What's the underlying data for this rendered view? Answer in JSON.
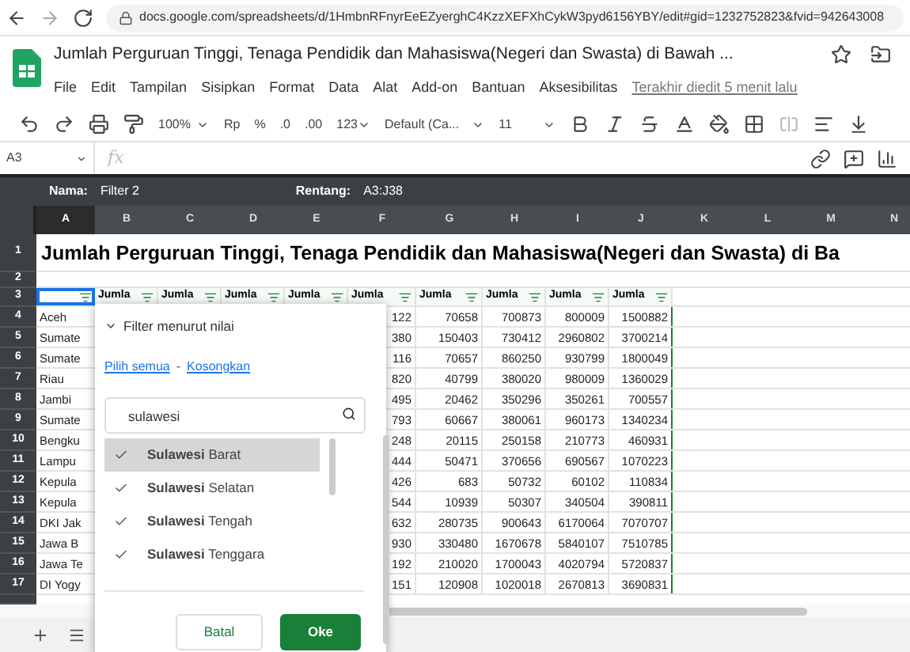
{
  "browser": {
    "url": "docs.google.com/spreadsheets/d/1HmbnRFnyrEeEZyerghC4KzzXEFXhCykW3pyd6156YBY/edit#gid=1232752823&fvid=942643008"
  },
  "document": {
    "title": "Jumlah Perguruan Tinggi, Tenaga Pendidik dan Mahasiswa(Negeri dan Swasta) di Bawah ...",
    "menu": [
      "File",
      "Edit",
      "Tampilan",
      "Sisipkan",
      "Format",
      "Data",
      "Alat",
      "Add-on",
      "Bantuan",
      "Aksesibilitas"
    ],
    "last_edit": "Terakhir diedit 5 menit lalu"
  },
  "toolbar": {
    "zoom": "100%",
    "currency": "Rp",
    "percent": "%",
    "decimal_less": ".0",
    "decimal_more": ".00",
    "number_format": "123",
    "font": "Default (Ca...",
    "font_size": "11"
  },
  "formula_bar": {
    "cell_ref": "A3",
    "fx": "fx"
  },
  "filter_bar": {
    "name_label": "Nama:",
    "name": "Filter 2",
    "range_label": "Rentang:",
    "range": "A3:J38"
  },
  "sheet": {
    "columns": [
      {
        "letter": "A",
        "selected": true
      },
      {
        "letter": "B",
        "selected": false
      },
      {
        "letter": "C",
        "selected": false
      },
      {
        "letter": "D",
        "selected": false
      },
      {
        "letter": "E",
        "selected": false
      },
      {
        "letter": "F",
        "selected": false
      },
      {
        "letter": "G",
        "selected": false
      },
      {
        "letter": "H",
        "selected": false
      },
      {
        "letter": "I",
        "selected": false
      },
      {
        "letter": "J",
        "selected": false
      },
      {
        "letter": "K",
        "selected": false
      },
      {
        "letter": "L",
        "selected": false
      },
      {
        "letter": "M",
        "selected": false
      },
      {
        "letter": "N",
        "selected": false
      }
    ],
    "title_row": {
      "number": "1",
      "text": "Jumlah Perguruan Tinggi, Tenaga Pendidik dan Mahasiswa(Negeri dan Swasta) di Ba"
    },
    "empty_row": {
      "number": "2"
    },
    "header_row": {
      "number": "3",
      "headers": [
        "Jumla",
        "Jumla",
        "Jumla",
        "Jumla",
        "Jumla",
        "Jumla",
        "Jumla",
        "Jumla",
        "Jumla"
      ]
    },
    "data_rows": [
      {
        "number": "4",
        "A": "Aceh",
        "F": "122",
        "G": "70658",
        "H": "700873",
        "I": "800009",
        "J": "1500882"
      },
      {
        "number": "5",
        "A": "Sumate",
        "F": "380",
        "G": "150403",
        "H": "730412",
        "I": "2960802",
        "J": "3700214"
      },
      {
        "number": "6",
        "A": "Sumate",
        "F": "116",
        "G": "70657",
        "H": "860250",
        "I": "930799",
        "J": "1800049"
      },
      {
        "number": "7",
        "A": "Riau",
        "F": "820",
        "G": "40799",
        "H": "380020",
        "I": "980009",
        "J": "1360029"
      },
      {
        "number": "8",
        "A": "Jambi",
        "F": "495",
        "G": "20462",
        "H": "350296",
        "I": "350261",
        "J": "700557"
      },
      {
        "number": "9",
        "A": "Sumate",
        "F": "793",
        "G": "60667",
        "H": "380061",
        "I": "960173",
        "J": "1340234"
      },
      {
        "number": "10",
        "A": "Bengku",
        "F": "248",
        "G": "20115",
        "H": "250158",
        "I": "210773",
        "J": "460931"
      },
      {
        "number": "11",
        "A": "Lampu",
        "F": "444",
        "G": "50471",
        "H": "370656",
        "I": "690567",
        "J": "1070223"
      },
      {
        "number": "12",
        "A": "Kepula",
        "F": "426",
        "G": "683",
        "H": "50732",
        "I": "60102",
        "J": "110834"
      },
      {
        "number": "13",
        "A": "Kepula",
        "F": "544",
        "G": "10939",
        "H": "50307",
        "I": "340504",
        "J": "390811"
      },
      {
        "number": "14",
        "A": "DKI Jak",
        "F": "632",
        "G": "280735",
        "H": "900643",
        "I": "6170064",
        "J": "7070707"
      },
      {
        "number": "15",
        "A": "Jawa B",
        "F": "930",
        "G": "330480",
        "H": "1670678",
        "I": "5840107",
        "J": "7510785"
      },
      {
        "number": "16",
        "A": "Jawa Te",
        "F": "192",
        "G": "210020",
        "H": "1700043",
        "I": "4020794",
        "J": "5720837"
      },
      {
        "number": "17",
        "A": "DI Yogy",
        "F": "151",
        "G": "120908",
        "H": "1020018",
        "I": "2670813",
        "J": "3690831"
      }
    ]
  },
  "filter_popup": {
    "section": "Filter menurut nilai",
    "expanded": true,
    "select_all": "Pilih semua",
    "separator": "-",
    "clear": "Kosongkan",
    "search": {
      "value": "sulawesi"
    },
    "items": [
      {
        "label": "**Sulawesi** Barat",
        "checked": true,
        "selected": true
      },
      {
        "label": "**Sulawesi** Selatan",
        "checked": true,
        "selected": false
      },
      {
        "label": "**Sulawesi** Tengah",
        "checked": true,
        "selected": false
      },
      {
        "label": "**Sulawesi** Tenggara",
        "checked": true,
        "selected": false
      }
    ],
    "cancel": "Batal",
    "ok": "Oke"
  }
}
